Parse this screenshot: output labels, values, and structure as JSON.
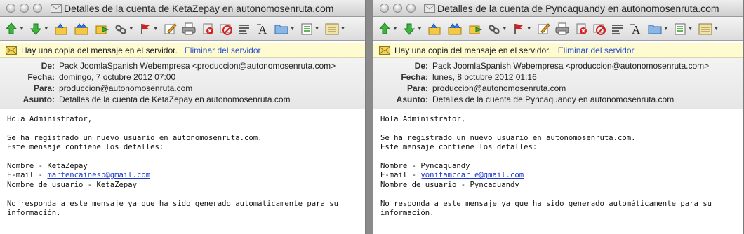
{
  "windows": [
    {
      "title": "Detalles de la cuenta de KetaZepay en autonomosenruta.com",
      "server_notice": "Hay una copia del mensaje en el servidor.",
      "server_link": "Eliminar del servidor",
      "headers": {
        "de_label": "De:",
        "de": "Pack JoomlaSpanish Webempresa <produccion@autonomosenruta.com>",
        "fecha_label": "Fecha:",
        "fecha": "domingo, 7 octubre 2012 07:00",
        "para_label": "Para:",
        "para": "produccion@autonomosenruta.com",
        "asunto_label": "Asunto:",
        "asunto": "Detalles de la cuenta de KetaZepay en autonomosenruta.com"
      },
      "body": {
        "greeting": "Hola Administrator,",
        "line1": "Se ha registrado un nuevo usuario en autonomosenruta.com.",
        "line2": "Este mensaje contiene los detalles:",
        "nombre": "Nombre - KetaZepay",
        "email_prefix": "E-mail - ",
        "email": "martencainesb@gmail.com",
        "usuario": "Nombre de usuario - KetaZepay",
        "footer1": "No responda a este mensaje ya que ha sido generado automáticamente para su",
        "footer2": "información."
      }
    },
    {
      "title": "Detalles de la cuenta de Pyncaquandy en autonomosenruta.com",
      "server_notice": "Hay una copia del mensaje en el servidor.",
      "server_link": "Eliminar del servidor",
      "headers": {
        "de_label": "De:",
        "de": "Pack JoomlaSpanish Webempresa <produccion@autonomosenruta.com>",
        "fecha_label": "Fecha:",
        "fecha": "lunes, 8 octubre 2012 01:16",
        "para_label": "Para:",
        "para": "produccion@autonomosenruta.com",
        "asunto_label": "Asunto:",
        "asunto": "Detalles de la cuenta de Pyncaquandy en autonomosenruta.com"
      },
      "body": {
        "greeting": "Hola Administrator,",
        "line1": "Se ha registrado un nuevo usuario en autonomosenruta.com.",
        "line2": "Este mensaje contiene los detalles:",
        "nombre": "Nombre - Pyncaquandy",
        "email_prefix": "E-mail - ",
        "email": "yonitamccarle@gmail.com",
        "usuario": "Nombre de usuario - Pyncaquandy",
        "footer1": "No responda a este mensaje ya que ha sido generado automáticamente para su",
        "footer2": "información."
      }
    }
  ],
  "toolbar_icons": [
    "get-mail-icon",
    "send-icon",
    "reply-icon",
    "reply-all-icon",
    "forward-icon",
    "link-icon",
    "flag-icon",
    "compose-icon",
    "print-icon",
    "delete-icon",
    "junk-icon",
    "filter-icon",
    "font-icon",
    "folder-icon",
    "view-icon",
    "notes-icon"
  ],
  "colors": {
    "notice_bg": "#fdfbcf",
    "link": "#2b50d8",
    "email_link": "#1a37d0"
  }
}
